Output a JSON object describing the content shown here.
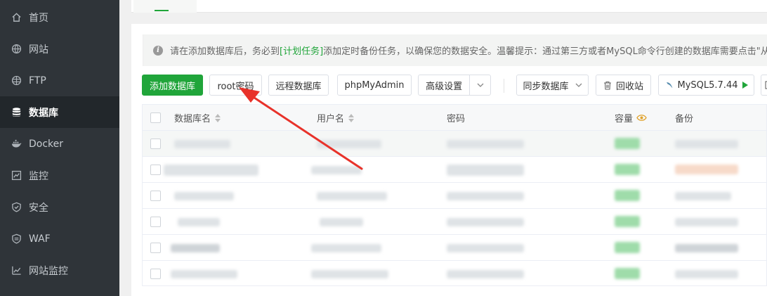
{
  "sidebar": {
    "items": [
      {
        "label": "首页",
        "icon": "home-icon"
      },
      {
        "label": "网站",
        "icon": "globe-icon"
      },
      {
        "label": "FTP",
        "icon": "ftp-globe-icon"
      },
      {
        "label": "数据库",
        "icon": "database-icon",
        "active": true
      },
      {
        "label": "Docker",
        "icon": "docker-icon"
      },
      {
        "label": "监控",
        "icon": "monitor-icon"
      },
      {
        "label": "安全",
        "icon": "shield-icon"
      },
      {
        "label": "WAF",
        "icon": "waf-shield-icon"
      },
      {
        "label": "网站监控",
        "icon": "chart-icon"
      }
    ]
  },
  "notice": {
    "prefix": "请在添加数据库后，务必到",
    "link": "[计划任务]",
    "suffix": "添加定时备份任务，以确保您的数据安全。温馨提示：通过第三方或者MySQL命令行创建的数据库需要点击\"从服"
  },
  "toolbar": {
    "add_db": "添加数据库",
    "root_pwd": "root密码",
    "remote_db": "远程数据库",
    "phpmyadmin": "phpMyAdmin",
    "advanced": "高级设置",
    "sync_db": "同步数据库",
    "recycle": "回收站",
    "mysql_version": "MySQL5.7.44"
  },
  "table": {
    "headers": {
      "db_name": "数据库名",
      "username": "用户名",
      "password": "密码",
      "capacity": "容量",
      "backup": "备份"
    }
  },
  "colors": {
    "accent": "#20a53a",
    "sidebar_bg": "#2f3439",
    "arrow": "#e8322a"
  }
}
